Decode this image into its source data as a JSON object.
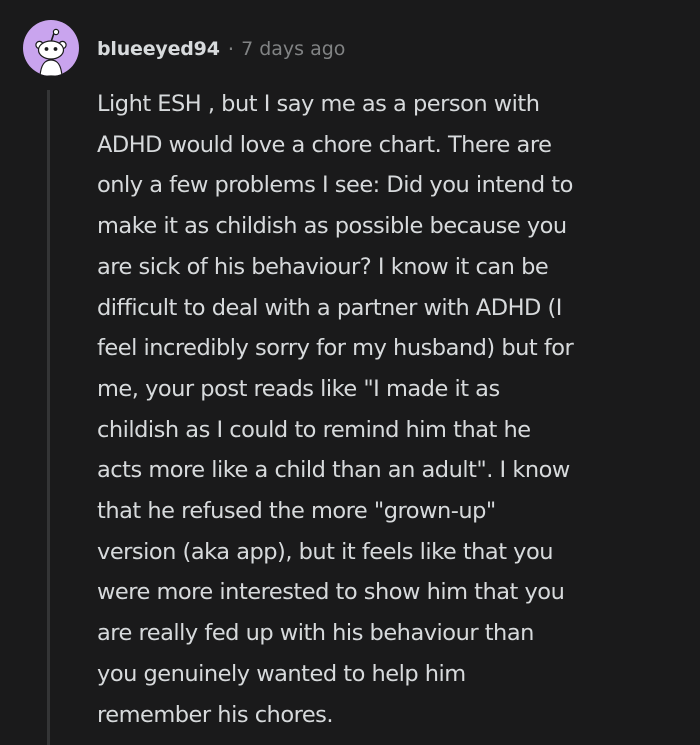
{
  "comment": {
    "username": "blueeyed94",
    "separator": "·",
    "timestamp": "7 days ago",
    "avatar_icon": "reddit-snoo-avatar",
    "colors": {
      "background": "#1a1a1b",
      "avatar_bg": "#c9a4ee",
      "text": "#d7dadc",
      "meta_text": "#818384",
      "thread_line": "#343536"
    },
    "body_lines": [
      "Light ESH , but I say me as a person with",
      "ADHD would love a chore chart. There are",
      "only a few problems I see: Did you intend to",
      "make it as childish as possible because you",
      "are sick of his behaviour? I know it can be",
      "difficult to deal with a partner with ADHD (I",
      "feel incredibly sorry for my husband) but for",
      "me, your post reads like \"I made it as",
      "childish as I could to remind him that he",
      "acts more like a child than an adult\". I know",
      "that he refused the more \"grown-up\"",
      "version (aka app), but it feels like that you",
      "were more interested to show him that you",
      "are really fed up with his behaviour than",
      "you genuinely wanted to help him",
      "remember his chores."
    ]
  }
}
